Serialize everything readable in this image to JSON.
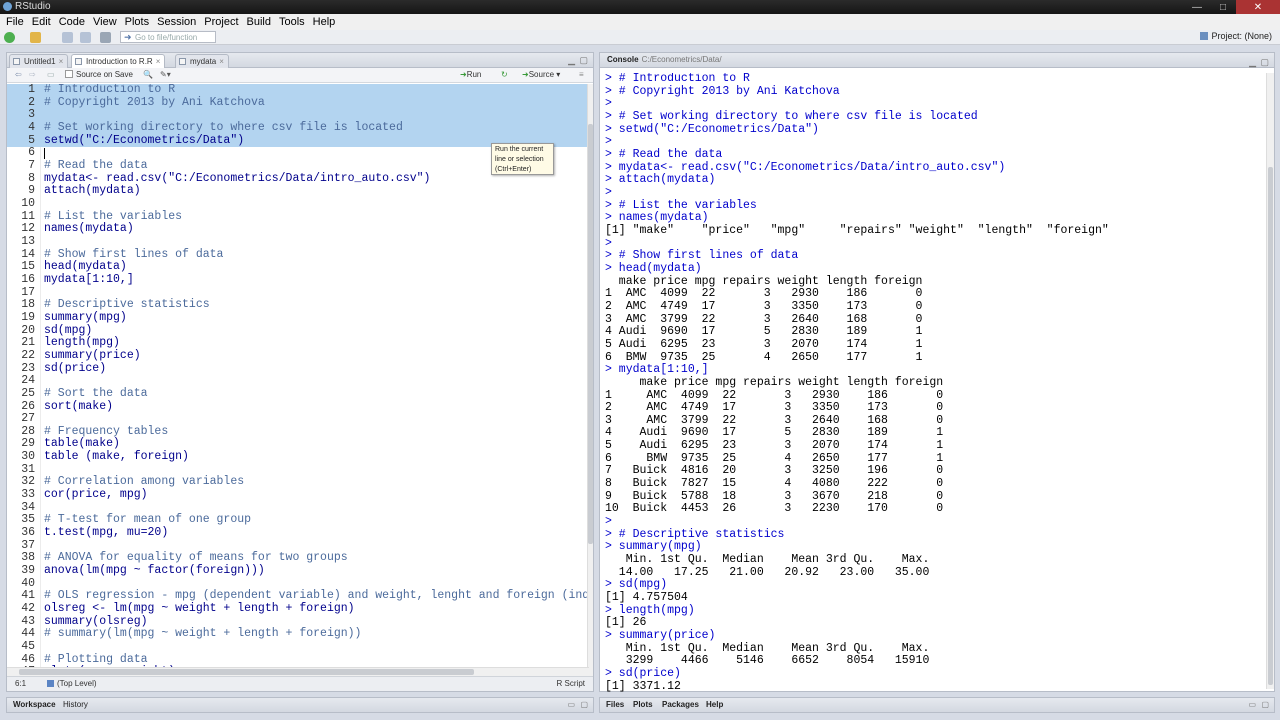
{
  "window": {
    "title": "RStudio",
    "minimize": "—",
    "maximize": "□",
    "close": "✕"
  },
  "menu": [
    "File",
    "Edit",
    "Code",
    "View",
    "Plots",
    "Session",
    "Project",
    "Build",
    "Tools",
    "Help"
  ],
  "toolbar": {
    "goto_placeholder": "Go to file/function",
    "project": "Project: (None)"
  },
  "editor": {
    "tabs": [
      {
        "label": "Untitled1"
      },
      {
        "label": "Introduction to R.R"
      },
      {
        "label": "mydata"
      }
    ],
    "source_on_save": "Source on Save",
    "run_label": "Run",
    "source_label": "Source",
    "tooltip": [
      "Run the current",
      "line or selection",
      "(Ctrl+Enter)"
    ],
    "lines": [
      "# Introduction to R",
      "# Copyright 2013 by Ani Katchova",
      "",
      "# Set working directory to where csv file is located",
      "setwd(\"C:/Econometrics/Data\")",
      "",
      "# Read the data",
      "mydata<- read.csv(\"C:/Econometrics/Data/intro_auto.csv\")",
      "attach(mydata)",
      "",
      "# List the variables",
      "names(mydata)",
      "",
      "# Show first lines of data",
      "head(mydata)",
      "mydata[1:10,]",
      "",
      "# Descriptive statistics",
      "summary(mpg)",
      "sd(mpg)",
      "length(mpg)",
      "summary(price)",
      "sd(price)",
      "",
      "# Sort the data",
      "sort(make)",
      "",
      "# Frequency tables",
      "table(make)",
      "table (make, foreign)",
      "",
      "# Correlation among variables",
      "cor(price, mpg)",
      "",
      "# T-test for mean of one group",
      "t.test(mpg, mu=20)",
      "",
      "# ANOVA for equality of means for two groups",
      "anova(lm(mpg ~ factor(foreign)))",
      "",
      "# OLS regression - mpg (dependent variable) and weight, lenght and foreign (indep",
      "olsreg <- lm(mpg ~ weight + length + foreign)",
      "summary(olsreg)",
      "# summary(lm(mpg ~ weight + length + foreign))",
      "",
      "# Plotting data",
      "plot (mpg ~ weight)"
    ],
    "status_pos": "6:1",
    "status_level": "(Top Level)",
    "status_type": "R Script"
  },
  "console": {
    "title": "Console",
    "path": "C:/Econometrics/Data/",
    "lines": [
      "> # Introduction to R",
      "> # Copyright 2013 by Ani Katchova",
      ">",
      "> # Set working directory to where csv file is located",
      "> setwd(\"C:/Econometrics/Data\")",
      ">",
      "> # Read the data",
      "> mydata<- read.csv(\"C:/Econometrics/Data/intro_auto.csv\")",
      "> attach(mydata)",
      ">",
      "> # List the variables",
      "> names(mydata)",
      "[1] \"make\"    \"price\"   \"mpg\"     \"repairs\" \"weight\"  \"length\"  \"foreign\"",
      ">",
      "> # Show first lines of data",
      "> head(mydata)",
      "  make price mpg repairs weight length foreign",
      "1  AMC  4099  22       3   2930    186       0",
      "2  AMC  4749  17       3   3350    173       0",
      "3  AMC  3799  22       3   2640    168       0",
      "4 Audi  9690  17       5   2830    189       1",
      "5 Audi  6295  23       3   2070    174       1",
      "6  BMW  9735  25       4   2650    177       1",
      "> mydata[1:10,]",
      "     make price mpg repairs weight length foreign",
      "1     AMC  4099  22       3   2930    186       0",
      "2     AMC  4749  17       3   3350    173       0",
      "3     AMC  3799  22       3   2640    168       0",
      "4    Audi  9690  17       5   2830    189       1",
      "5    Audi  6295  23       3   2070    174       1",
      "6     BMW  9735  25       4   2650    177       1",
      "7   Buick  4816  20       3   3250    196       0",
      "8   Buick  7827  15       4   4080    222       0",
      "9   Buick  5788  18       3   3670    218       0",
      "10  Buick  4453  26       3   2230    170       0",
      ">",
      "> # Descriptive statistics",
      "> summary(mpg)",
      "   Min. 1st Qu.  Median    Mean 3rd Qu.    Max.",
      "  14.00   17.25   21.00   20.92   23.00   35.00",
      "> sd(mpg)",
      "[1] 4.757504",
      "> length(mpg)",
      "[1] 26",
      "> summary(price)",
      "   Min. 1st Qu.  Median    Mean 3rd Qu.    Max.",
      "   3299    4466    5146    6652    8054   15910",
      "> sd(price)",
      "[1] 3371.12"
    ]
  },
  "bottom_left_tabs": [
    "Workspace",
    "History"
  ],
  "bottom_right_tabs": [
    "Files",
    "Plots",
    "Packages",
    "Help"
  ]
}
